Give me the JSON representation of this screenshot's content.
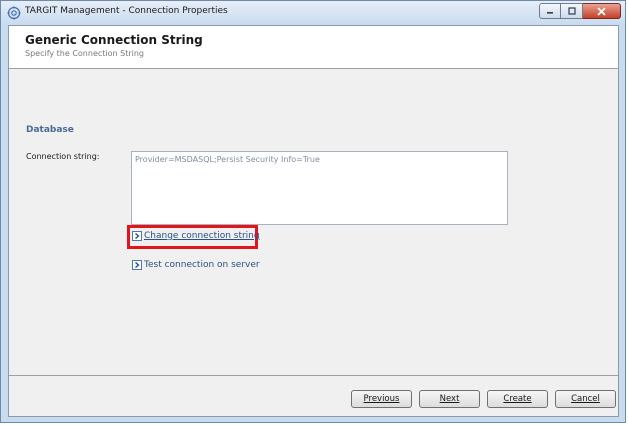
{
  "window": {
    "title": "TARGIT Management - Connection Properties"
  },
  "header": {
    "title": "Generic Connection String",
    "subtitle": "Specify the Connection String"
  },
  "section": {
    "label": "Database"
  },
  "connection": {
    "label": "Connection string:",
    "value": "Provider=MSDASQL;Persist Security Info=True"
  },
  "links": {
    "change": "Change connection string",
    "test": "Test connection on server"
  },
  "buttons": {
    "previous": "Previous",
    "next": "Next",
    "create": "Create",
    "cancel": "Cancel"
  },
  "colors": {
    "highlight": "#e3141c",
    "link": "#2a4f86",
    "section": "#4a6a96"
  }
}
